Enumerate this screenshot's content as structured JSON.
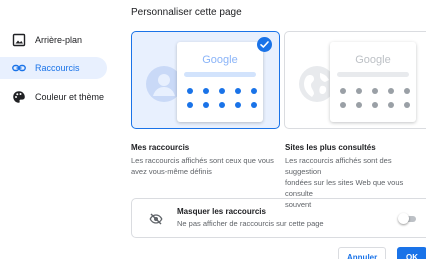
{
  "sidebar": {
    "items": [
      {
        "label": "Arrière-plan",
        "icon": "image-icon",
        "selected": false
      },
      {
        "label": "Raccourcis",
        "icon": "link-icon",
        "selected": true
      },
      {
        "label": "Couleur et thème",
        "icon": "palette-icon",
        "selected": false
      }
    ]
  },
  "dialog": {
    "title": "Personnaliser cette page"
  },
  "options": [
    {
      "preview_logo": "Google",
      "title": "Mes raccourcis",
      "description": "Les raccourcis affichés sont ceux que vous\navez vous-même définis",
      "selected": true
    },
    {
      "preview_logo": "Google",
      "title": "Sites les plus consultés",
      "description": "Les raccourcis affichés sont des suggestion\nfondées sur les sites Web que vous consulte\nsouvent",
      "selected": false
    }
  ],
  "hide_shortcuts": {
    "title": "Masquer les raccourcis",
    "subtitle": "Ne pas afficher de raccourcis sur cette page",
    "enabled": false,
    "icon": "eye-off-icon"
  },
  "buttons": {
    "cancel": "Annuler",
    "ok": "OK"
  },
  "colors": {
    "accent": "#1a73e8",
    "selected_bg": "#e8f0fe",
    "preview_grey": "#dadce0"
  }
}
